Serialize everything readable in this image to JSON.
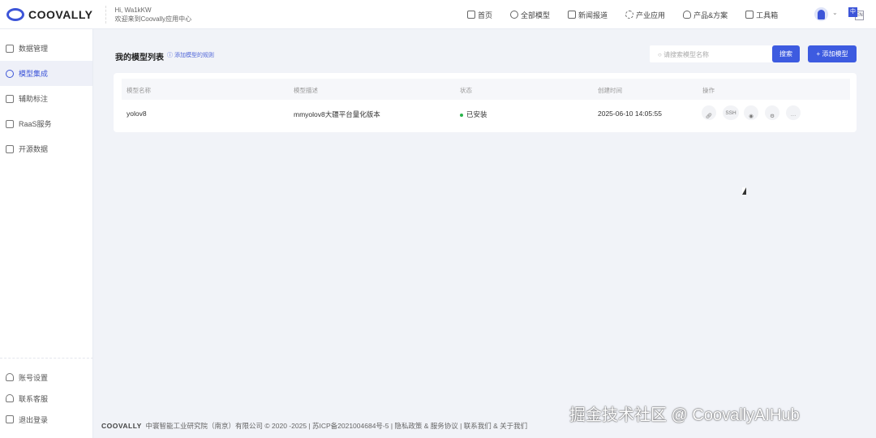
{
  "header": {
    "logo": "COOVALLY",
    "greeting": "Hi, Wa1kKW",
    "welcome": "欢迎来到Coovally应用中心",
    "nav": [
      {
        "label": "首页",
        "icon": "home-icon"
      },
      {
        "label": "全部模型",
        "icon": "model-icon"
      },
      {
        "label": "新闻报道",
        "icon": "news-icon"
      },
      {
        "label": "产业应用",
        "icon": "industry-icon"
      },
      {
        "label": "产品&方案",
        "icon": "bulb-icon"
      },
      {
        "label": "工具箱",
        "icon": "toolbox-icon"
      }
    ],
    "lang_primary": "中",
    "lang_secondary": "EN"
  },
  "sidebar": {
    "items": [
      {
        "label": "数据管理"
      },
      {
        "label": "模型集成",
        "active": true
      },
      {
        "label": "辅助标注"
      },
      {
        "label": "RaaS服务"
      },
      {
        "label": "开源数据"
      }
    ],
    "bottom": [
      {
        "label": "账号设置"
      },
      {
        "label": "联系客服"
      },
      {
        "label": "退出登录"
      }
    ]
  },
  "main": {
    "title": "我的模型列表",
    "rule_link": "添加模型的规则",
    "search_placeholder": "请搜索模型名称",
    "search_button": "搜索",
    "add_button": "+ 添加模型",
    "columns": [
      "模型名称",
      "模型描述",
      "状态",
      "创建时间",
      "操作"
    ],
    "rows": [
      {
        "name": "yolov8",
        "desc": "mmyolov8大疆平台量化版本",
        "status": "已安装",
        "created": "2025-06-10 14:05:55",
        "ssh": "SSH"
      }
    ],
    "status_color": "#28b34a"
  },
  "footer": {
    "brand": "COOVALLY",
    "text": "中寰智能工业研究院（南京）有限公司 © 2020 -2025 | 苏ICP备2021004684号-5 | 隐私政策 & 服务协议 | 联系我们 & 关于我们"
  },
  "watermark": "掘金技术社区 @ CoovallyAIHub"
}
